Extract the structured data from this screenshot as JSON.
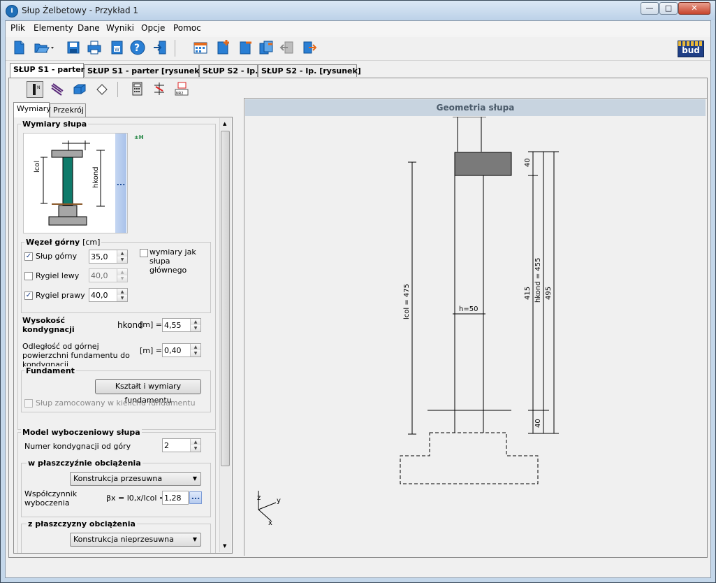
{
  "window": {
    "title": "Słup Żelbetowy - Przykład 1",
    "app_icon_letter": "I",
    "minimize": "—",
    "maximize": "□",
    "close": "✕"
  },
  "menu": [
    "Plik",
    "Elementy",
    "Dane",
    "Wyniki",
    "Opcje",
    "Pomoc"
  ],
  "toolbar": {
    "brand_logo_text": "bud"
  },
  "tabs": [
    "SŁUP S1 - parter",
    "SŁUP S1 - parter  [rysunek]",
    "SŁUP S2 - Ip.",
    "SŁUP S2 - Ip.  [rysunek]"
  ],
  "left_tabs": [
    "Wymiary",
    "Przekrój"
  ],
  "dims_group": {
    "title": "Wymiary słupa",
    "img_lcol": "lcol",
    "img_hkond": "hkond",
    "img_more": "...",
    "hint_icon_text": "±H"
  },
  "wezel": {
    "title": "Węzeł górny",
    "unit": "[cm]",
    "slup_gorny": {
      "label": "Słup górny",
      "value": "35,0",
      "checked": true
    },
    "rygiel_lewy": {
      "label": "Rygiel lewy",
      "value": "40,0",
      "checked": false
    },
    "rygiel_prawy": {
      "label": "Rygiel prawy",
      "value": "40,0",
      "checked": true
    },
    "wymiary_jak_label": "wymiary jak słupa głównego"
  },
  "wysokosc": {
    "label": "Wysokość kondygnacji",
    "symbol": "hkond",
    "unit": "[m] =",
    "value": "4,55"
  },
  "odleglosc": {
    "label": "Odległość od górnej powierzchni fundamentu do kondygnacji",
    "unit": "[m] =",
    "value": "0,40"
  },
  "fundament": {
    "title": "Fundament",
    "button": "Kształt i wymiary fundamentu",
    "checkbox_label": "Słup zamocowany w kielichu fundamentu"
  },
  "model": {
    "title": "Model wyboczeniowy słupa",
    "numer_label": "Numer kondygnacji od góry",
    "numer_value": "2",
    "w_plaszczyznie": "w płaszczyźnie obciążenia",
    "select1": "Konstrukcja przesuwna",
    "wspolczynnik_label": "Współczynnik wyboczenia",
    "beta_formula": "βx = l0,x/lcol =",
    "beta_value": "1,28",
    "more_button": "...",
    "z_plaszczyzny": "z płaszczyzny obciążenia",
    "select2": "Konstrukcja nieprzesuwna"
  },
  "drawing": {
    "header": "Geometria słupa",
    "h_label": "h=50",
    "lcol_label": "lcol = 475",
    "dim_40_top": "40",
    "dim_415": "415",
    "dim_hkond": "hkond = 455",
    "dim_495": "495",
    "dim_40_bottom": "40",
    "axis_z": "z",
    "axis_y": "y",
    "axis_x": "x"
  },
  "colors": {
    "accent": "#1f6fb8",
    "column_fill": "#0f7a6a",
    "beam_fill": "#7a7a7a",
    "header_bg": "#c8d4e0"
  }
}
